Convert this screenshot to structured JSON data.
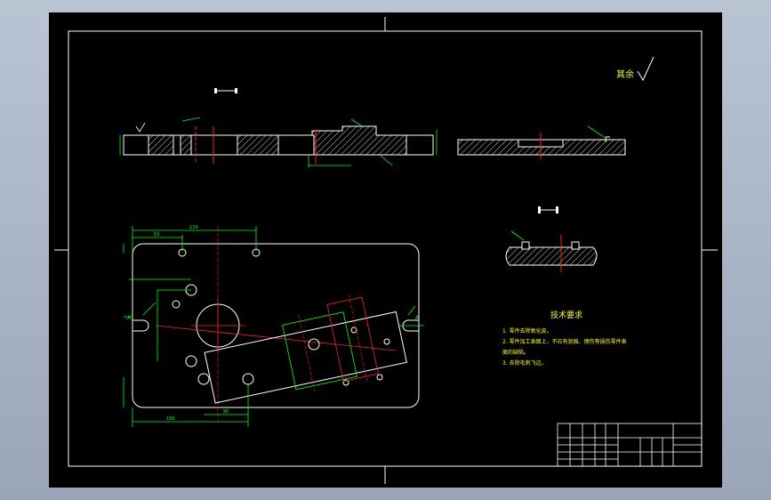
{
  "drawing": {
    "roughness_label": "其余",
    "section_label_top": "A — A",
    "section_label_right": "I — I",
    "tech_title": "技术要求",
    "tech_items": [
      "1. 零件去除氧化皮。",
      "2. 零件加工表面上，不应有划痕、擦伤等损伤零件表",
      "面的缺陷。",
      "3. 去除毛刺飞边。"
    ],
    "dim_labels": {
      "top_width": "134",
      "top_left": "63",
      "left_a": "A",
      "right_a": "A",
      "bottom_width": "186",
      "bottom_mid": "90"
    },
    "colors": {
      "line": "#ffffff",
      "dim": "#00ff00",
      "center": "#ff2020",
      "hatch": "#ffffff",
      "text_yellow": "#ffff00",
      "border": "#ffffff"
    }
  }
}
